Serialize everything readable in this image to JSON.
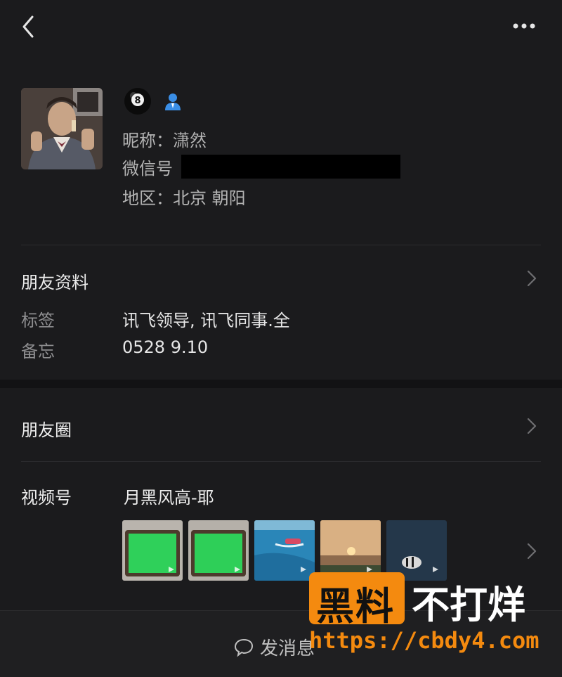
{
  "profile": {
    "nickname_label": "昵称：",
    "nickname": "潇然",
    "wechat_id_label": "微信号",
    "region_label": "地区：",
    "region": "北京 朝阳"
  },
  "friend_info": {
    "title": "朋友资料",
    "tags_key": "标签",
    "tags_val": "讯飞领导, 讯飞同事.全",
    "memo_key": "备忘",
    "memo_val": "0528   9.10"
  },
  "moments": {
    "title": "朋友圈"
  },
  "channels": {
    "title": "视频号",
    "name": "月黑风高-耶",
    "thumbnails": [
      "green-table",
      "green-table",
      "speedboat",
      "sunset",
      "fish"
    ]
  },
  "bottom": {
    "send_message": "发消息"
  },
  "watermark": {
    "box_text": "黑料",
    "right_text": "不打烊",
    "url": "https://cbdy4.com"
  },
  "colors": {
    "background": "#1b1b1d",
    "watermark_orange": "#f48a0f",
    "verified_blue": "#3a8ee6"
  },
  "icons": [
    "back-icon",
    "more-icon",
    "eight-ball-icon",
    "person-badge-icon",
    "chevron-right-icon",
    "chat-bubble-icon"
  ]
}
